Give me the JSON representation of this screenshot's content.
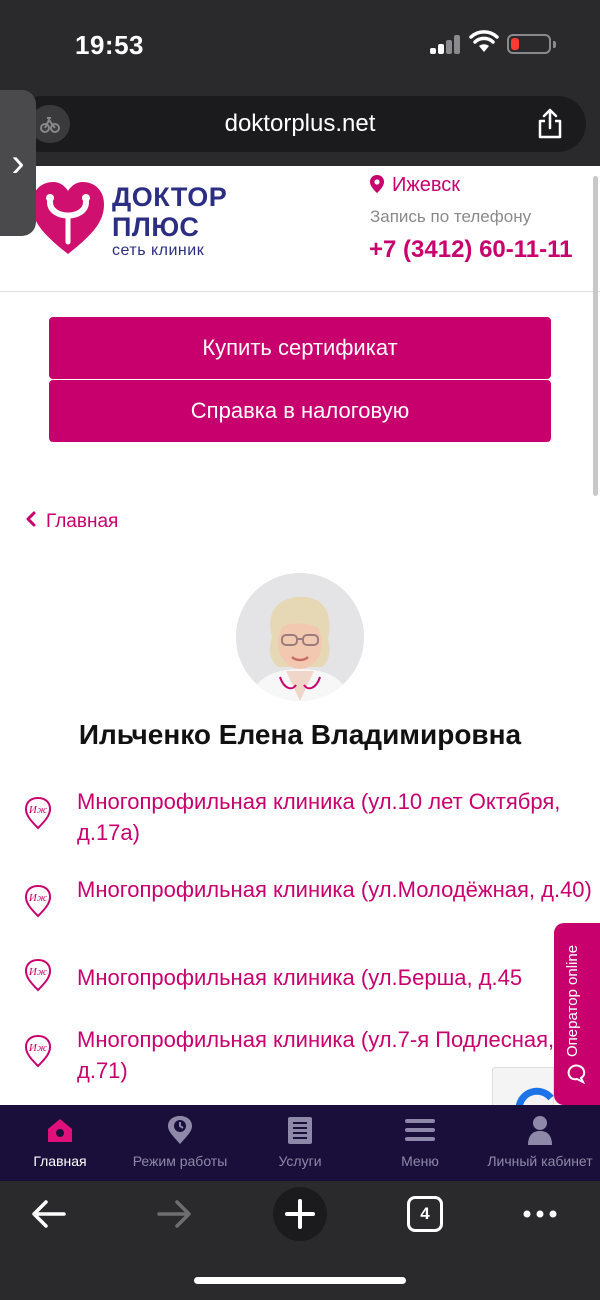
{
  "status_bar": {
    "time": "19:53"
  },
  "browser": {
    "url": "doktorplus.net",
    "tab_count": "4"
  },
  "header": {
    "brand_line1": "ДОКТОР",
    "brand_line2": "ПЛЮС",
    "brand_tagline": "сеть клиник",
    "city": "Ижевск",
    "phone_label": "Запись по телефону",
    "phone": "+7 (3412) 60-11-11"
  },
  "actions": {
    "buy_certificate": "Купить сертификат",
    "tax_certificate": "Справка в налоговую"
  },
  "breadcrumb": {
    "home": "Главная"
  },
  "doctor": {
    "name": "Ильченко Елена Владимировна"
  },
  "clinics": [
    {
      "badge": "Иж",
      "name": "Многопрофильная клиника (ул.10 лет Октября, д.17а)"
    },
    {
      "badge": "Иж",
      "name": "Многопрофильная клиника (ул.Молодёжная, д.40)"
    },
    {
      "badge": "Иж",
      "name": "Многопрофильная клиника (ул.Берша, д.45"
    },
    {
      "badge": "Иж",
      "name": "Многопрофильная клиника (ул.7-я Подлесная, д.71)"
    }
  ],
  "operator": {
    "label": "Оператор online"
  },
  "site_nav": [
    {
      "label": "Главная",
      "icon": "home-icon",
      "active": true
    },
    {
      "label": "Режим работы",
      "icon": "clock-pin-icon"
    },
    {
      "label": "Услуги",
      "icon": "list-icon"
    },
    {
      "label": "Меню",
      "icon": "menu-icon"
    },
    {
      "label": "Личный кабинет",
      "icon": "person-icon"
    }
  ],
  "colors": {
    "brand": "#c8006e",
    "brand_dark": "#2c2e83",
    "nav_bg": "#1a0f3a"
  }
}
